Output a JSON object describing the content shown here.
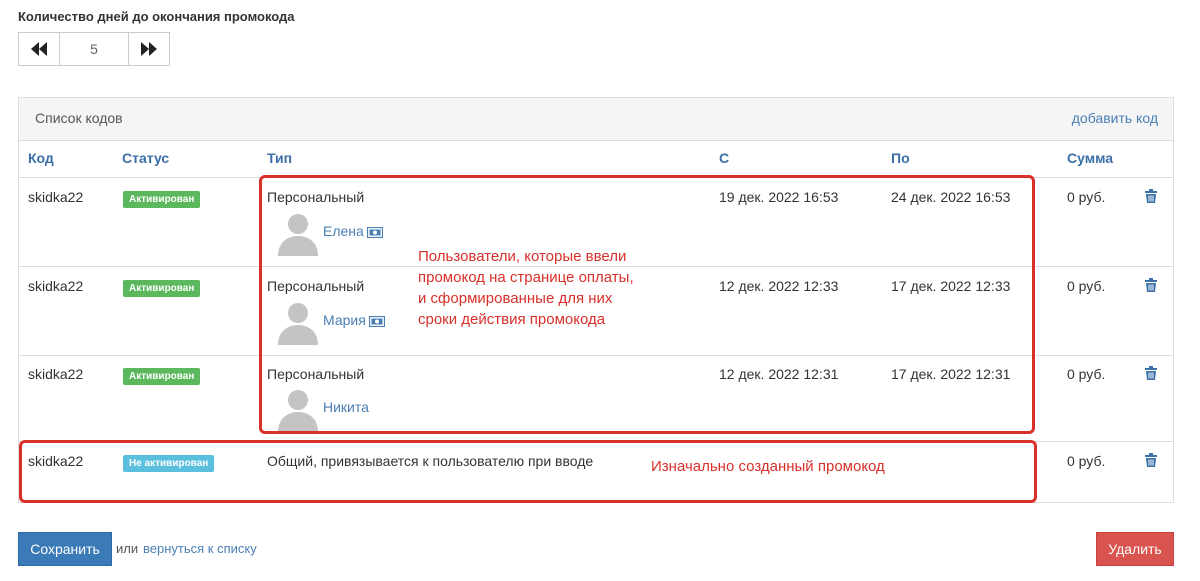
{
  "days_setting": {
    "label": "Количество дней до окончания промокода",
    "value": "5"
  },
  "codes_panel": {
    "title": "Список кодов",
    "add_link": "добавить код",
    "columns": {
      "code": "Код",
      "status": "Статус",
      "type": "Тип",
      "from": "С",
      "to": "По",
      "sum": "Сумма"
    },
    "rows": [
      {
        "code": "skidka22",
        "status": "Активирован",
        "type": "Персональный",
        "user": "Елена",
        "from": "19 дек. 2022 16:53",
        "to": "24 дек. 2022 16:53",
        "sum": "0 руб."
      },
      {
        "code": "skidka22",
        "status": "Активирован",
        "type": "Персональный",
        "user": "Мария",
        "from": "12 дек. 2022 12:33",
        "to": "17 дек. 2022 12:33",
        "sum": "0 руб."
      },
      {
        "code": "skidka22",
        "status": "Активирован",
        "type": "Персональный",
        "user": "Никита",
        "from": "12 дек. 2022 12:31",
        "to": "17 дек. 2022 12:31",
        "sum": "0 руб."
      },
      {
        "code": "skidka22",
        "status": "Не активирован",
        "type": "Общий, привязывается к пользователю при вводе",
        "sum": "0 руб."
      }
    ]
  },
  "annotations": {
    "users_note_lines": [
      "Пользователи, которые ввели",
      "промокод на странице оплаты,",
      "и сформированные для них",
      "сроки действия промокода"
    ],
    "original_note": "Изначально созданный промокод"
  },
  "footer": {
    "save": "Сохранить",
    "or": "или",
    "back": "вернуться к списку",
    "delete": "Удалить"
  },
  "colors": {
    "link": "#4a7fb5",
    "status_active": "#5cb85c",
    "status_inactive": "#5bc0de",
    "primary": "#3a7ab7",
    "danger": "#d9534f",
    "highlight": "#d9302a"
  }
}
